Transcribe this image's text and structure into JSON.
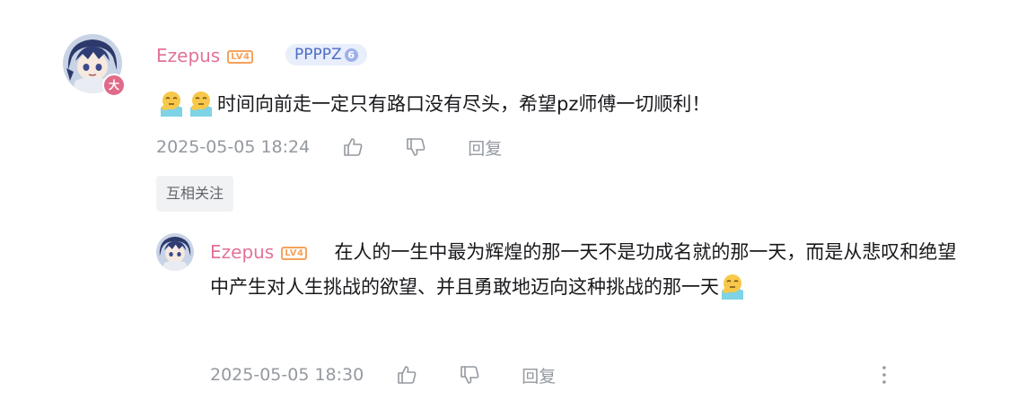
{
  "main_comment": {
    "username": "Ezepus",
    "level_badge": "LV4",
    "fan_badge": {
      "name": "PPPPZ",
      "level": "6"
    },
    "avatar_badge": "大",
    "content": "时间向前走一定只有路口没有尽头，希望pz师傅一切顺利！",
    "emojis": [
      "thinking-face-emoji",
      "thinking-face-emoji"
    ],
    "timestamp": "2025-05-05 18:24",
    "reply_label": "回复",
    "follow_tag": "互相关注"
  },
  "sub_reply": {
    "username": "Ezepus",
    "level_badge": "LV4",
    "content": "在人的一生中最为辉煌的那一天不是功成名就的那一天，而是从悲叹和绝望中产生对人生挑战的欲望、并且勇敢地迈向这种挑战的那一天",
    "emojis": [
      "thinking-face-emoji"
    ],
    "timestamp": "2025-05-05 18:30",
    "reply_label": "回复"
  },
  "colors": {
    "username": "#e2729a",
    "level_badge": "#f6a25c",
    "fan_badge_bg": "#e8eefb",
    "fan_badge_text": "#4e6dc3",
    "meta_text": "#9499a0"
  }
}
